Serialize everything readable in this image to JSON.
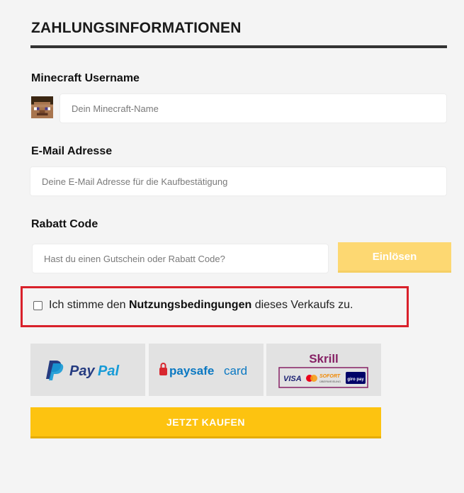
{
  "page": {
    "title": "ZAHLUNGSINFORMATIONEN"
  },
  "form": {
    "username_label": "Minecraft Username",
    "username_placeholder": "Dein Minecraft-Name",
    "email_label": "E-Mail Adresse",
    "email_placeholder": "Deine E-Mail Adresse für die Kaufbestätigung",
    "coupon_label": "Rabatt Code",
    "coupon_placeholder": "Hast du einen Gutschein oder Rabatt Code?",
    "redeem_label": "Einlösen",
    "terms_prefix": "Ich stimme den",
    "terms_link": "Nutzungsbedingungen",
    "terms_suffix": "dieses Verkaufs zu.",
    "terms_checked": false
  },
  "payment_methods": {
    "paypal": {
      "brand_a": "Pay",
      "brand_b": "Pal"
    },
    "paysafecard": {
      "brand_a": "paysafe",
      "brand_b": "card"
    },
    "skrill": {
      "brand": "Skrill",
      "sub_logos": [
        "VISA",
        "SOFORT",
        "ÜBERWEISUNG",
        "giro pay"
      ]
    }
  },
  "actions": {
    "buy_label": "JETZT KAUFEN"
  },
  "colors": {
    "accent": "#fdc310",
    "accent_disabled": "#fdd872",
    "highlight_border": "#d9212b",
    "paypal_dark": "#253b80",
    "paypal_light": "#179bd7",
    "paysafe_red": "#d8262e",
    "paysafe_blue": "#0a78c2",
    "skrill_purple": "#862165"
  }
}
